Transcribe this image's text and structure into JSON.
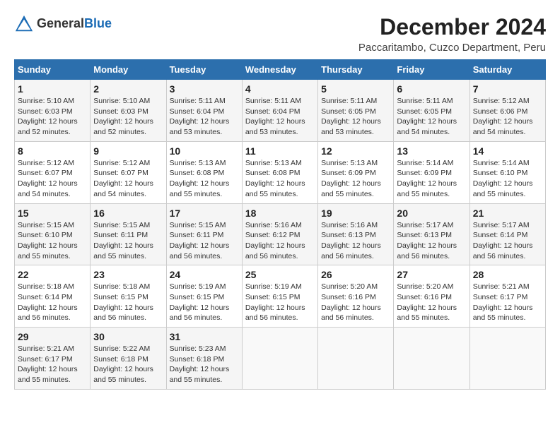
{
  "logo": {
    "general": "General",
    "blue": "Blue"
  },
  "title": "December 2024",
  "subtitle": "Paccaritambo, Cuzco Department, Peru",
  "weekdays": [
    "Sunday",
    "Monday",
    "Tuesday",
    "Wednesday",
    "Thursday",
    "Friday",
    "Saturday"
  ],
  "weeks": [
    [
      {
        "day": "1",
        "sunrise": "5:10 AM",
        "sunset": "6:03 PM",
        "daylight": "12 hours and 52 minutes."
      },
      {
        "day": "2",
        "sunrise": "5:10 AM",
        "sunset": "6:03 PM",
        "daylight": "12 hours and 52 minutes."
      },
      {
        "day": "3",
        "sunrise": "5:11 AM",
        "sunset": "6:04 PM",
        "daylight": "12 hours and 53 minutes."
      },
      {
        "day": "4",
        "sunrise": "5:11 AM",
        "sunset": "6:04 PM",
        "daylight": "12 hours and 53 minutes."
      },
      {
        "day": "5",
        "sunrise": "5:11 AM",
        "sunset": "6:05 PM",
        "daylight": "12 hours and 53 minutes."
      },
      {
        "day": "6",
        "sunrise": "5:11 AM",
        "sunset": "6:05 PM",
        "daylight": "12 hours and 54 minutes."
      },
      {
        "day": "7",
        "sunrise": "5:12 AM",
        "sunset": "6:06 PM",
        "daylight": "12 hours and 54 minutes."
      }
    ],
    [
      {
        "day": "8",
        "sunrise": "5:12 AM",
        "sunset": "6:07 PM",
        "daylight": "12 hours and 54 minutes."
      },
      {
        "day": "9",
        "sunrise": "5:12 AM",
        "sunset": "6:07 PM",
        "daylight": "12 hours and 54 minutes."
      },
      {
        "day": "10",
        "sunrise": "5:13 AM",
        "sunset": "6:08 PM",
        "daylight": "12 hours and 55 minutes."
      },
      {
        "day": "11",
        "sunrise": "5:13 AM",
        "sunset": "6:08 PM",
        "daylight": "12 hours and 55 minutes."
      },
      {
        "day": "12",
        "sunrise": "5:13 AM",
        "sunset": "6:09 PM",
        "daylight": "12 hours and 55 minutes."
      },
      {
        "day": "13",
        "sunrise": "5:14 AM",
        "sunset": "6:09 PM",
        "daylight": "12 hours and 55 minutes."
      },
      {
        "day": "14",
        "sunrise": "5:14 AM",
        "sunset": "6:10 PM",
        "daylight": "12 hours and 55 minutes."
      }
    ],
    [
      {
        "day": "15",
        "sunrise": "5:15 AM",
        "sunset": "6:10 PM",
        "daylight": "12 hours and 55 minutes."
      },
      {
        "day": "16",
        "sunrise": "5:15 AM",
        "sunset": "6:11 PM",
        "daylight": "12 hours and 55 minutes."
      },
      {
        "day": "17",
        "sunrise": "5:15 AM",
        "sunset": "6:11 PM",
        "daylight": "12 hours and 56 minutes."
      },
      {
        "day": "18",
        "sunrise": "5:16 AM",
        "sunset": "6:12 PM",
        "daylight": "12 hours and 56 minutes."
      },
      {
        "day": "19",
        "sunrise": "5:16 AM",
        "sunset": "6:13 PM",
        "daylight": "12 hours and 56 minutes."
      },
      {
        "day": "20",
        "sunrise": "5:17 AM",
        "sunset": "6:13 PM",
        "daylight": "12 hours and 56 minutes."
      },
      {
        "day": "21",
        "sunrise": "5:17 AM",
        "sunset": "6:14 PM",
        "daylight": "12 hours and 56 minutes."
      }
    ],
    [
      {
        "day": "22",
        "sunrise": "5:18 AM",
        "sunset": "6:14 PM",
        "daylight": "12 hours and 56 minutes."
      },
      {
        "day": "23",
        "sunrise": "5:18 AM",
        "sunset": "6:15 PM",
        "daylight": "12 hours and 56 minutes."
      },
      {
        "day": "24",
        "sunrise": "5:19 AM",
        "sunset": "6:15 PM",
        "daylight": "12 hours and 56 minutes."
      },
      {
        "day": "25",
        "sunrise": "5:19 AM",
        "sunset": "6:15 PM",
        "daylight": "12 hours and 56 minutes."
      },
      {
        "day": "26",
        "sunrise": "5:20 AM",
        "sunset": "6:16 PM",
        "daylight": "12 hours and 56 minutes."
      },
      {
        "day": "27",
        "sunrise": "5:20 AM",
        "sunset": "6:16 PM",
        "daylight": "12 hours and 55 minutes."
      },
      {
        "day": "28",
        "sunrise": "5:21 AM",
        "sunset": "6:17 PM",
        "daylight": "12 hours and 55 minutes."
      }
    ],
    [
      {
        "day": "29",
        "sunrise": "5:21 AM",
        "sunset": "6:17 PM",
        "daylight": "12 hours and 55 minutes."
      },
      {
        "day": "30",
        "sunrise": "5:22 AM",
        "sunset": "6:18 PM",
        "daylight": "12 hours and 55 minutes."
      },
      {
        "day": "31",
        "sunrise": "5:23 AM",
        "sunset": "6:18 PM",
        "daylight": "12 hours and 55 minutes."
      },
      null,
      null,
      null,
      null
    ]
  ]
}
